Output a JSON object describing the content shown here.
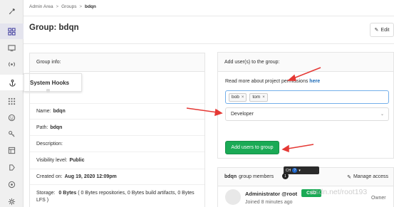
{
  "breadcrumb": [
    "Admin Area",
    "Groups",
    "bdqn"
  ],
  "page_title": "Group: bdqn",
  "edit_button": "Edit",
  "tooltip": "System Hooks",
  "group_info": {
    "header": "Group info:",
    "name_label": "Name:",
    "name_value": "bdqn",
    "path_label": "Path:",
    "path_value": "bdqn",
    "description_label": "Description:",
    "visibility_label": "Visibility level:",
    "visibility_value": "Public",
    "created_label": "Created on:",
    "created_value": "Aug 19, 2020 12:09pm",
    "storage_label": "Storage:",
    "storage_value": "0 Bytes",
    "storage_detail": "( 0 Bytes repositories, 0 Bytes build artifacts, 0 Bytes LFS )"
  },
  "add_users": {
    "header": "Add user(s) to the group:",
    "perm_text": "Read more about project permissions",
    "perm_link": "here",
    "tokens": [
      "bob",
      "tom"
    ],
    "token_remove": "×",
    "role_value": "Developer",
    "submit_label": "Add users to group"
  },
  "members": {
    "group_name": "bdqn",
    "header_suffix": "group members",
    "count_badge": "1",
    "manage_label": "Manage access",
    "toolbar_label": "CH",
    "member_name": "Administrator @root",
    "member_tag": "CSD",
    "member_joined": "Joined 8 minutes ago",
    "member_role": "Owner"
  },
  "watermark": "csdn.net/root193",
  "colors": {
    "accent_green": "#1aaa55",
    "link_blue": "#1b69b6",
    "arrow_red": "#e53935",
    "sidebar_active": "#4a47a3"
  }
}
